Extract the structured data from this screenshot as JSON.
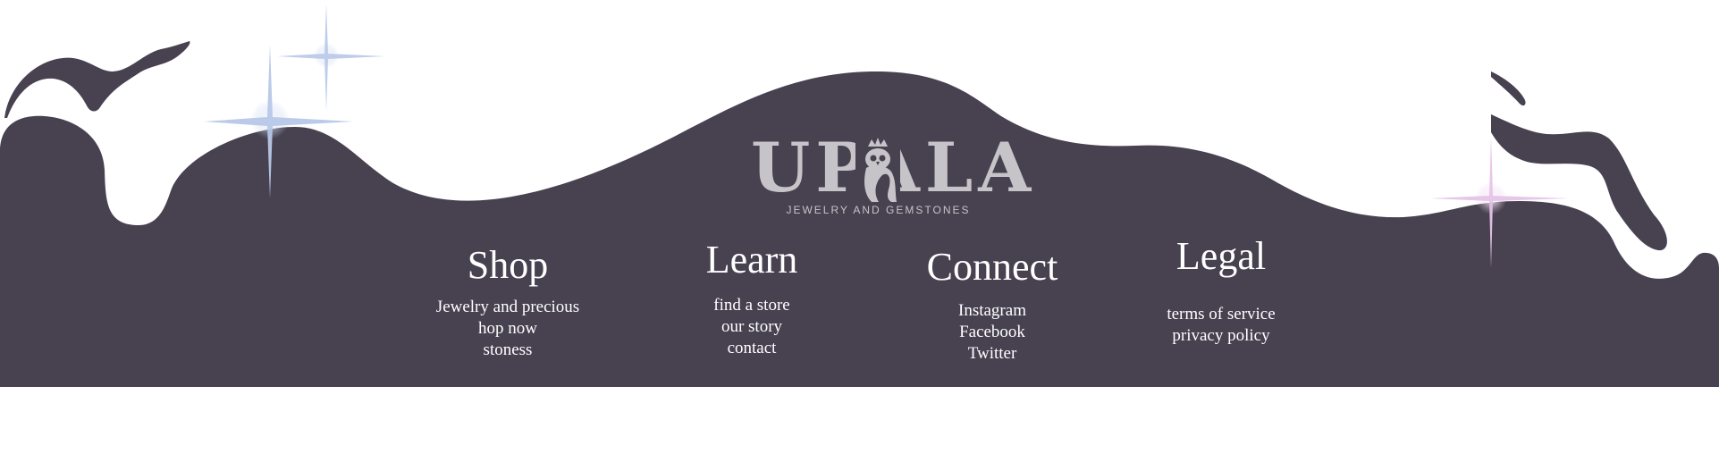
{
  "brand": {
    "name": "UPALA",
    "tagline": "JEWELRY AND GEMSTONES",
    "logo_icon": "owl-icon"
  },
  "colors": {
    "footer_bg": "#474150",
    "text": "#ffffff",
    "logo": "#c6c4c8",
    "sparkle_blue": "#b8c8e8",
    "sparkle_pink": "#e6c4e8"
  },
  "columns": [
    {
      "title": "Shop",
      "links": [
        "Jewelry and precious",
        "hop now",
        "stoness"
      ]
    },
    {
      "title": "Learn",
      "links": [
        "find a store",
        "our story",
        "contact"
      ]
    },
    {
      "title": "Connect",
      "links": [
        "Instagram",
        "Facebook",
        "Twitter"
      ]
    },
    {
      "title": "Legal",
      "links": [
        "terms of service",
        "privacy policy"
      ]
    }
  ]
}
